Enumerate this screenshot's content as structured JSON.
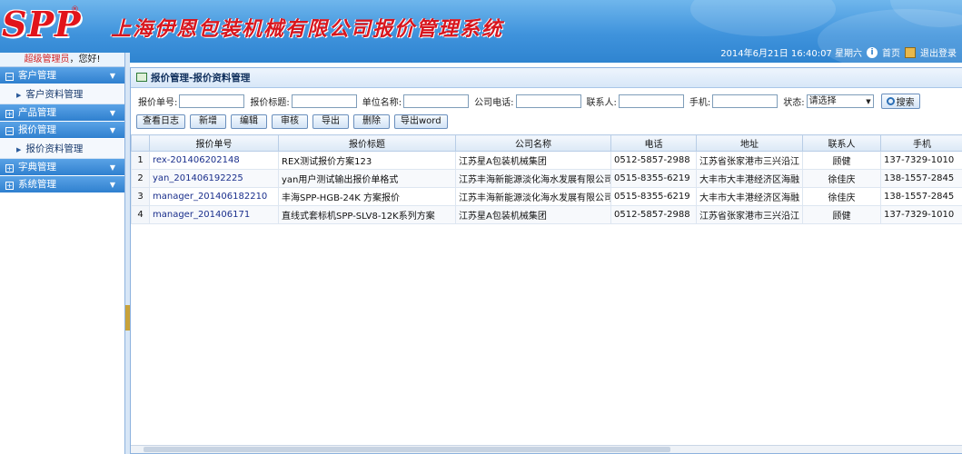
{
  "header": {
    "logo": "SPP",
    "logo_reg": "®",
    "title": "上海伊恩包装机械有限公司报价管理系统",
    "datetime": "2014年6月21日 16:40:07 星期六",
    "home_label": "首页",
    "logout_label": "退出登录"
  },
  "sidebar": {
    "welcome_user": "超级管理员",
    "welcome_suffix": "，您好!",
    "groups": [
      {
        "label": "客户管理",
        "sub": "客户资料管理"
      },
      {
        "label": "产品管理"
      },
      {
        "label": "报价管理",
        "sub": "报价资料管理"
      },
      {
        "label": "字典管理"
      },
      {
        "label": "系统管理"
      }
    ]
  },
  "panel": {
    "title": "报价管理-报价资料管理"
  },
  "search": {
    "quote_no_label": "报价单号:",
    "quote_title_label": "报价标题:",
    "company_label": "单位名称:",
    "phone_label": "公司电话:",
    "contact_label": "联系人:",
    "mobile_label": "手机:",
    "status_label": "状态:",
    "status_value": "请选择",
    "search_button": "搜索"
  },
  "toolbar": {
    "log": "查看日志",
    "add": "新增",
    "edit": "编辑",
    "audit": "审核",
    "export": "导出",
    "delete": "删除",
    "export_word": "导出word"
  },
  "table": {
    "columns": [
      "",
      "报价单号",
      "报价标题",
      "公司名称",
      "电话",
      "地址",
      "联系人",
      "手机"
    ],
    "rows": [
      {
        "idx": "1",
        "no": "rex-201406202148",
        "title": "REX测试报价方案123",
        "company": "江苏星A包装机械集团",
        "phone": "0512-5857-2988",
        "address": "江苏省张家港市三兴沿江",
        "contact": "顾健",
        "mobile": "137-7329-1010"
      },
      {
        "idx": "2",
        "no": "yan_201406192225",
        "title": "yan用户测试输出报价单格式",
        "company": "江苏丰海新能源淡化海水发展有限公司",
        "phone": "0515-8355-6219",
        "address": "大丰市大丰港经济区海融",
        "contact": "徐佳庆",
        "mobile": "138-1557-2845"
      },
      {
        "idx": "3",
        "no": "manager_201406182210",
        "title": "丰海SPP-HGB-24K 方案报价",
        "company": "江苏丰海新能源淡化海水发展有限公司",
        "phone": "0515-8355-6219",
        "address": "大丰市大丰港经济区海融",
        "contact": "徐佳庆",
        "mobile": "138-1557-2845"
      },
      {
        "idx": "4",
        "no": "manager_201406171",
        "title": "直线式套标机SPP-SLV8-12K系列方案",
        "company": "江苏星A包装机械集团",
        "phone": "0512-5857-2988",
        "address": "江苏省张家港市三兴沿江",
        "contact": "顾健",
        "mobile": "137-7329-1010"
      }
    ]
  },
  "colors": {
    "header_blue": "#3f93dc",
    "menu_blue": "#2f80cf",
    "title_red": "#d8161e",
    "link_blue": "#1a2f8c"
  }
}
